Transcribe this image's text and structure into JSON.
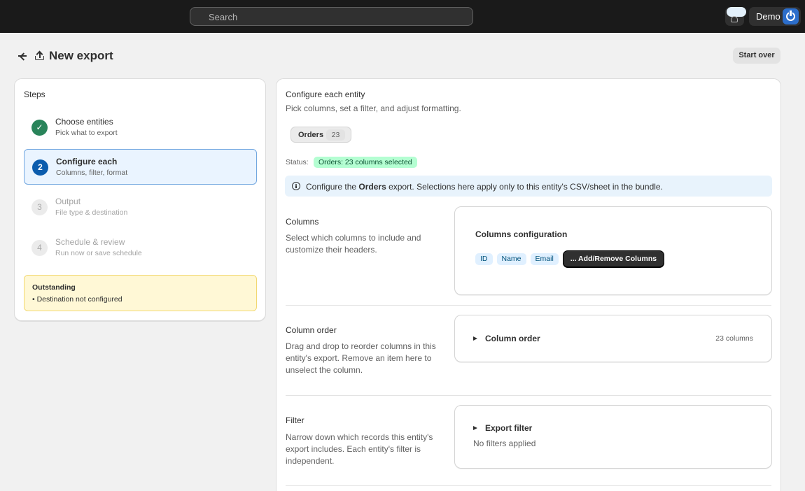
{
  "topbar": {
    "search_placeholder": "Search",
    "user_name": "Demo"
  },
  "header": {
    "title": "New export",
    "start_over": "Start over"
  },
  "steps": {
    "title": "Steps",
    "items": [
      {
        "badge": "✓",
        "title": "Choose entities",
        "subtitle": "Pick what to export",
        "state": "done"
      },
      {
        "badge": "2",
        "title": "Configure each",
        "subtitle": "Columns, filter, format",
        "state": "current"
      },
      {
        "badge": "3",
        "title": "Output",
        "subtitle": "File type & destination",
        "state": "todo"
      },
      {
        "badge": "4",
        "title": "Schedule & review",
        "subtitle": "Run now or save schedule",
        "state": "todo"
      }
    ],
    "outstanding": {
      "title": "Outstanding",
      "item": "• Destination not configured"
    }
  },
  "main": {
    "title": "Configure each entity",
    "subtitle": "Pick columns, set a filter, and adjust formatting.",
    "entity_tab": {
      "label": "Orders",
      "count": "23"
    },
    "status_label": "Status:",
    "status_badge": "Orders: 23 columns selected",
    "banner": {
      "prefix": "Configure the ",
      "entity": "Orders",
      "suffix": " export. Selections here apply only to this entity's CSV/sheet in the bundle."
    },
    "columns": {
      "label": "Columns",
      "description": "Select which columns to include and customize their headers.",
      "panel_title": "Columns configuration",
      "chips": [
        "ID",
        "Name",
        "Email"
      ],
      "add_remove": "... Add/Remove Columns"
    },
    "column_order": {
      "label": "Column order",
      "description": "Drag and drop to reorder columns in this entity's export. Remove an item here to unselect the column.",
      "panel_title": "Column order",
      "count": "23 columns"
    },
    "filter": {
      "label": "Filter",
      "description": "Narrow down which records this entity's export includes. Each entity's filter is independent.",
      "panel_title": "Export filter",
      "panel_sub": "No filters applied"
    }
  }
}
